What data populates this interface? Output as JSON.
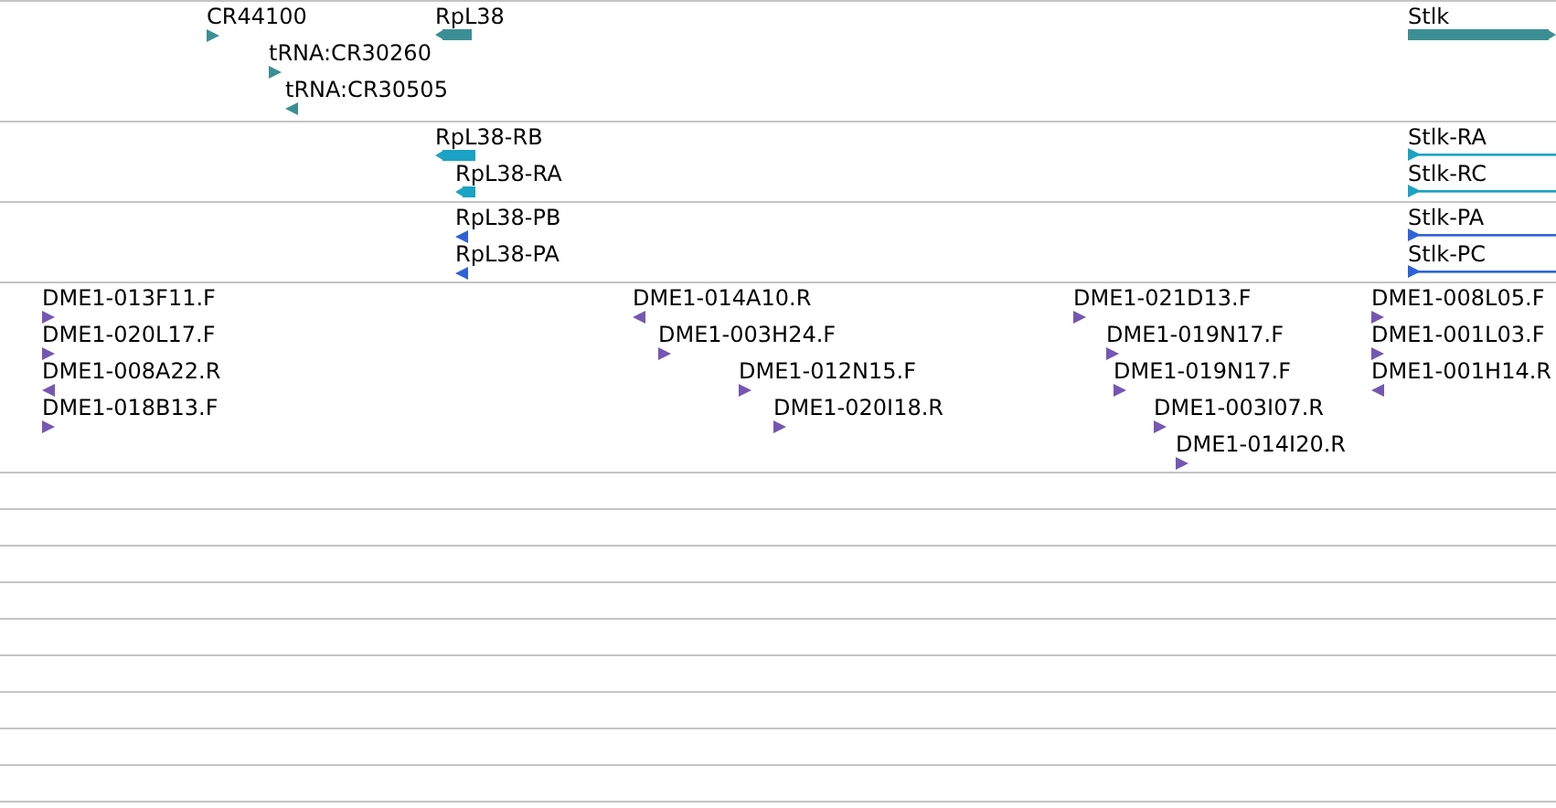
{
  "tracks": [
    {
      "kind": "genes",
      "color": "#3b8f94",
      "features": [
        {
          "label": "CR44100",
          "kind": "arrow",
          "reverse": false
        },
        {
          "label": "tRNA:CR30260",
          "kind": "arrow",
          "reverse": false
        },
        {
          "label": "tRNA:CR30505",
          "kind": "arrow",
          "reverse": true
        },
        {
          "label": "RpL38",
          "kind": "bar",
          "reverse": true
        },
        {
          "label": "Stlk",
          "kind": "bar",
          "reverse": false
        }
      ]
    },
    {
      "kind": "transcripts",
      "color": "#1aa3c4",
      "features": [
        {
          "label": "RpL38-RB",
          "kind": "bar",
          "reverse": true
        },
        {
          "label": "RpL38-RA",
          "kind": "bar",
          "reverse": true
        },
        {
          "label": "Stlk-RA",
          "kind": "line",
          "reverse": false
        },
        {
          "label": "Stlk-RC",
          "kind": "line",
          "reverse": false
        }
      ]
    },
    {
      "kind": "proteins",
      "color": "#2f62d6",
      "features": [
        {
          "label": "RpL38-PB",
          "kind": "arrow",
          "reverse": true
        },
        {
          "label": "RpL38-PA",
          "kind": "arrow",
          "reverse": true
        },
        {
          "label": "Stlk-PA",
          "kind": "line",
          "reverse": false
        },
        {
          "label": "Stlk-PC",
          "kind": "line",
          "reverse": false
        }
      ]
    },
    {
      "kind": "ests",
      "color": "#7457b3",
      "features": [
        {
          "label": "DME1-013F11.F",
          "kind": "arrow",
          "reverse": false
        },
        {
          "label": "DME1-020L17.F",
          "kind": "arrow",
          "reverse": false
        },
        {
          "label": "DME1-008A22.R",
          "kind": "arrow",
          "reverse": true
        },
        {
          "label": "DME1-018B13.F",
          "kind": "arrow",
          "reverse": false
        },
        {
          "label": "DME1-014A10.R",
          "kind": "arrow",
          "reverse": true
        },
        {
          "label": "DME1-003H24.F",
          "kind": "arrow",
          "reverse": false
        },
        {
          "label": "DME1-012N15.F",
          "kind": "arrow",
          "reverse": false
        },
        {
          "label": "DME1-020I18.R",
          "kind": "arrow",
          "reverse": false
        },
        {
          "label": "DME1-021D13.F",
          "kind": "arrow",
          "reverse": false
        },
        {
          "label": "DME1-019N17.F",
          "kind": "arrow",
          "reverse": false
        },
        {
          "label": "DME1-019N17.F",
          "kind": "arrow",
          "reverse": false
        },
        {
          "label": "DME1-003I07.R",
          "kind": "arrow",
          "reverse": false
        },
        {
          "label": "DME1-014I20.R",
          "kind": "arrow",
          "reverse": false
        },
        {
          "label": "DME1-008L05.F",
          "kind": "arrow",
          "reverse": false
        },
        {
          "label": "DME1-001L03.F",
          "kind": "arrow",
          "reverse": false
        },
        {
          "label": "DME1-001H14.R",
          "kind": "arrow",
          "reverse": true
        }
      ]
    },
    {
      "kind": "empty"
    },
    {
      "kind": "empty"
    },
    {
      "kind": "empty"
    },
    {
      "kind": "empty"
    },
    {
      "kind": "empty"
    },
    {
      "kind": "empty"
    },
    {
      "kind": "empty"
    },
    {
      "kind": "empty"
    },
    {
      "kind": "empty"
    }
  ]
}
